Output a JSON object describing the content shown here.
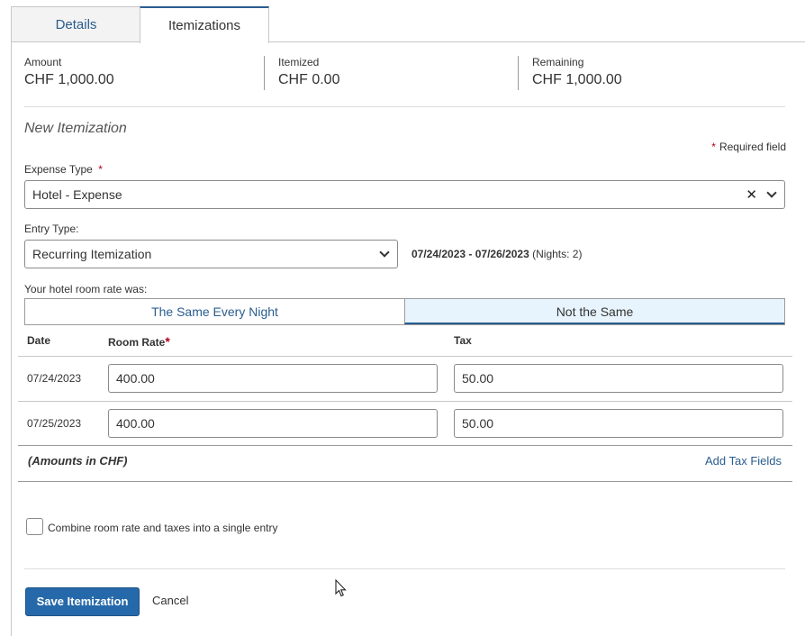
{
  "tabs": {
    "details": "Details",
    "itemizations": "Itemizations"
  },
  "summary": {
    "amount_label": "Amount",
    "amount_value": "CHF 1,000.00",
    "itemized_label": "Itemized",
    "itemized_value": "CHF 0.00",
    "remaining_label": "Remaining",
    "remaining_value": "CHF 1,000.00"
  },
  "form": {
    "title": "New Itemization",
    "required_note": "Required field",
    "required_star": "*",
    "expense_type_label": "Expense Type",
    "expense_type_value": "Hotel - Expense",
    "entry_type_label": "Entry Type:",
    "entry_type_value": "Recurring Itemization",
    "date_range": "07/24/2023 - 07/26/2023",
    "nights": "(Nights: 2)",
    "room_rate_question": "Your hotel room rate was:",
    "option_same": "The Same Every Night",
    "option_not_same": "Not the Same",
    "clear_glyph": "✕"
  },
  "table": {
    "col_date": "Date",
    "col_room_rate": "Room Rate",
    "col_tax": "Tax",
    "rows": [
      {
        "date": "07/24/2023",
        "room_rate": "400.00",
        "tax": "50.00"
      },
      {
        "date": "07/25/2023",
        "room_rate": "400.00",
        "tax": "50.00"
      }
    ],
    "amounts_note": "(Amounts in CHF)",
    "add_tax_fields": "Add Tax Fields"
  },
  "combine_label": "Combine room rate and taxes into a single entry",
  "buttons": {
    "save": "Save Itemization",
    "cancel": "Cancel"
  },
  "colors": {
    "accent": "#2669aa",
    "link": "#2a5d8f",
    "required": "#b00020",
    "selected_bg": "#e8f4fd"
  }
}
